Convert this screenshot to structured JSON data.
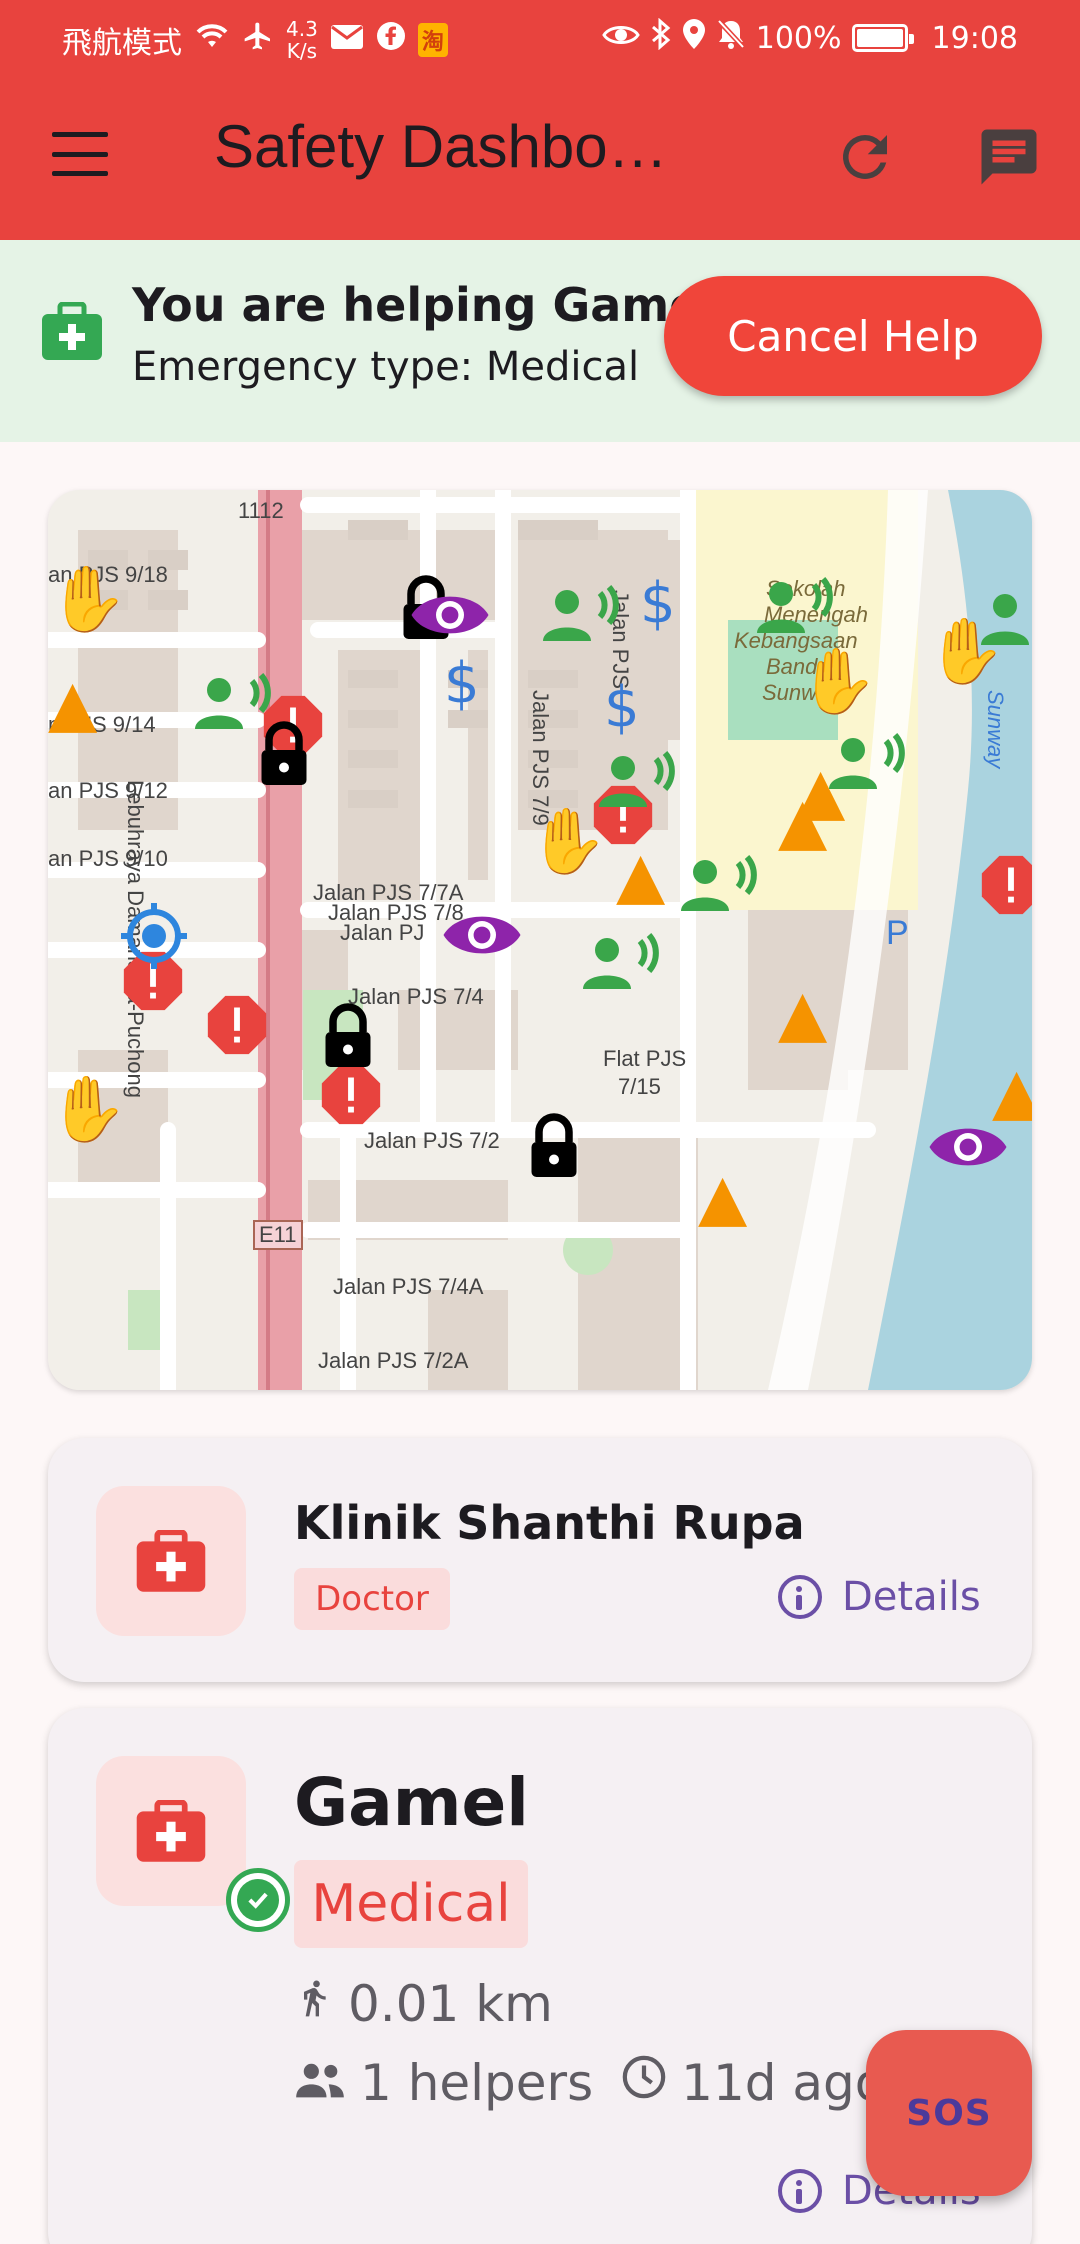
{
  "status_bar": {
    "left_text": "飛航模式",
    "speed_value": "4.3",
    "speed_unit": "K/s",
    "taobao_badge": "淘",
    "battery": "100%",
    "time": "19:08"
  },
  "app_bar": {
    "title": "Safety Dashbo…"
  },
  "banner": {
    "title": "You are helping Gamel",
    "subtitle": "Emergency type: Medical",
    "cancel_label": "Cancel Help",
    "accent_color": "#34a853"
  },
  "map": {
    "street_labels": [
      "1112",
      "an PJS 9/18",
      "n PJS 9/14",
      "an PJS 9/12",
      "an PJS 9/10",
      "Jalan PJS 7/7A",
      "Jalan PJS 7/8",
      "Jalan PJ",
      "Jalan PJS 7/4",
      "Jalan PJS 7/2",
      "Flat PJS",
      "7/15",
      "Jalan PJS 7/4A",
      "Jalan PJS 7/2A",
      "E11",
      "Lebuhraya Damansara-Puchong",
      "Jalan PJS 7/9",
      "Jalan PJS",
      "P",
      "Sekolah",
      "Menengah",
      "Kebangsaan",
      "Bandar",
      "Sunway",
      "Sunway"
    ]
  },
  "cards": [
    {
      "title": "Klinik Shanthi Rupa",
      "tag": "Doctor",
      "details_label": "Details"
    },
    {
      "title": "Gamel",
      "tag": "Medical",
      "distance": "0.01 km",
      "helpers": "1 helpers",
      "time_ago": "11d ago",
      "details_label": "Details"
    }
  ],
  "fab": {
    "label": "SOS"
  },
  "colors": {
    "primary": "#e8433e",
    "banner_bg": "#e5f3e6",
    "link": "#6b4fa6"
  }
}
